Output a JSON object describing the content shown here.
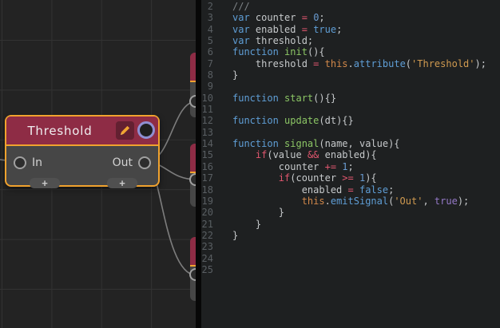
{
  "colors": {
    "canvas-bg": "#232323",
    "grid": "#323232",
    "node-header": "#8e2c45",
    "node-body": "#464646",
    "accent-orange": "#f0a22e",
    "editbtn-bg": "#632031",
    "badge-ring": "#8f8fd2",
    "port-ring": "#a0a0a0",
    "plus-bg": "#505050",
    "wire": "#7d7d7d",
    "separator": "#070707",
    "panel-bg": "#1e2021",
    "linenum": "#595e62",
    "tok-pln": "#c6c9cb",
    "tok-com": "#7e8387",
    "tok-kw": "#5f9ed6",
    "tok-fn": "#8cc665",
    "tok-op": "#e0566e",
    "tok-num": "#6a9bd0",
    "tok-str": "#d09a50",
    "tok-ths": "#d2884a",
    "tok-cst": "#9579c8"
  },
  "node": {
    "title": "Threshold",
    "in_label": "In",
    "out_label": "Out",
    "add_button_label": "+",
    "icons": {
      "edit": "pencil-icon",
      "state": "circle-badge-icon"
    }
  },
  "code": {
    "lines": [
      {
        "n": 2,
        "t": [
          [
            "com",
            "///"
          ]
        ]
      },
      {
        "n": 3,
        "t": [
          [
            "kw",
            "var"
          ],
          [
            "pln",
            " counter "
          ],
          [
            "op",
            "="
          ],
          [
            "pln",
            " "
          ],
          [
            "num",
            "0"
          ],
          [
            "pln",
            ";"
          ]
        ]
      },
      {
        "n": 4,
        "t": [
          [
            "kw",
            "var"
          ],
          [
            "pln",
            " enabled "
          ],
          [
            "op",
            "="
          ],
          [
            "pln",
            " "
          ],
          [
            "kw",
            "true"
          ],
          [
            "pln",
            ";"
          ]
        ]
      },
      {
        "n": 5,
        "t": [
          [
            "kw",
            "var"
          ],
          [
            "pln",
            " threshold;"
          ]
        ]
      },
      {
        "n": 6,
        "t": [
          [
            "kw",
            "function"
          ],
          [
            "pln",
            " "
          ],
          [
            "fn",
            "init"
          ],
          [
            "pln",
            "(){"
          ]
        ]
      },
      {
        "n": 7,
        "t": [
          [
            "pln",
            "    threshold "
          ],
          [
            "op",
            "="
          ],
          [
            "pln",
            " "
          ],
          [
            "ths",
            "this"
          ],
          [
            "pln",
            "."
          ],
          [
            "kw",
            "attribute"
          ],
          [
            "pln",
            "("
          ],
          [
            "str",
            "'Threshold'"
          ],
          [
            "pln",
            ");"
          ]
        ]
      },
      {
        "n": 8,
        "t": [
          [
            "pln",
            "}"
          ]
        ]
      },
      {
        "n": 9,
        "t": []
      },
      {
        "n": 10,
        "t": [
          [
            "kw",
            "function"
          ],
          [
            "pln",
            " "
          ],
          [
            "fn",
            "start"
          ],
          [
            "pln",
            "(){}"
          ]
        ]
      },
      {
        "n": 11,
        "t": []
      },
      {
        "n": 12,
        "t": [
          [
            "kw",
            "function"
          ],
          [
            "pln",
            " "
          ],
          [
            "fn",
            "update"
          ],
          [
            "pln",
            "(dt){}"
          ]
        ]
      },
      {
        "n": 13,
        "t": []
      },
      {
        "n": 14,
        "t": [
          [
            "kw",
            "function"
          ],
          [
            "pln",
            " "
          ],
          [
            "fn",
            "signal"
          ],
          [
            "pln",
            "(name, value){"
          ]
        ]
      },
      {
        "n": 15,
        "t": [
          [
            "pln",
            "    "
          ],
          [
            "op",
            "if"
          ],
          [
            "pln",
            "(value "
          ],
          [
            "op",
            "&&"
          ],
          [
            "pln",
            " enabled){"
          ]
        ]
      },
      {
        "n": 16,
        "t": [
          [
            "pln",
            "        counter "
          ],
          [
            "op",
            "+="
          ],
          [
            "pln",
            " "
          ],
          [
            "num",
            "1"
          ],
          [
            "pln",
            ";"
          ]
        ]
      },
      {
        "n": 17,
        "t": [
          [
            "pln",
            "        "
          ],
          [
            "op",
            "if"
          ],
          [
            "pln",
            "(counter "
          ],
          [
            "op",
            ">="
          ],
          [
            "pln",
            " "
          ],
          [
            "num",
            "1"
          ],
          [
            "pln",
            "){"
          ]
        ]
      },
      {
        "n": 18,
        "t": [
          [
            "pln",
            "            enabled "
          ],
          [
            "op",
            "="
          ],
          [
            "pln",
            " "
          ],
          [
            "kw",
            "false"
          ],
          [
            "pln",
            ";"
          ]
        ]
      },
      {
        "n": 19,
        "t": [
          [
            "pln",
            "            "
          ],
          [
            "ths",
            "this"
          ],
          [
            "pln",
            "."
          ],
          [
            "kw",
            "emitSignal"
          ],
          [
            "pln",
            "("
          ],
          [
            "str",
            "'Out'"
          ],
          [
            "pln",
            ", "
          ],
          [
            "cst",
            "true"
          ],
          [
            "pln",
            ");"
          ]
        ]
      },
      {
        "n": 20,
        "t": [
          [
            "pln",
            "        }"
          ]
        ]
      },
      {
        "n": 21,
        "t": [
          [
            "pln",
            "    }"
          ]
        ]
      },
      {
        "n": 22,
        "t": [
          [
            "pln",
            "}"
          ]
        ]
      },
      {
        "n": 23,
        "t": []
      },
      {
        "n": 24,
        "t": []
      },
      {
        "n": 25,
        "t": []
      }
    ]
  }
}
